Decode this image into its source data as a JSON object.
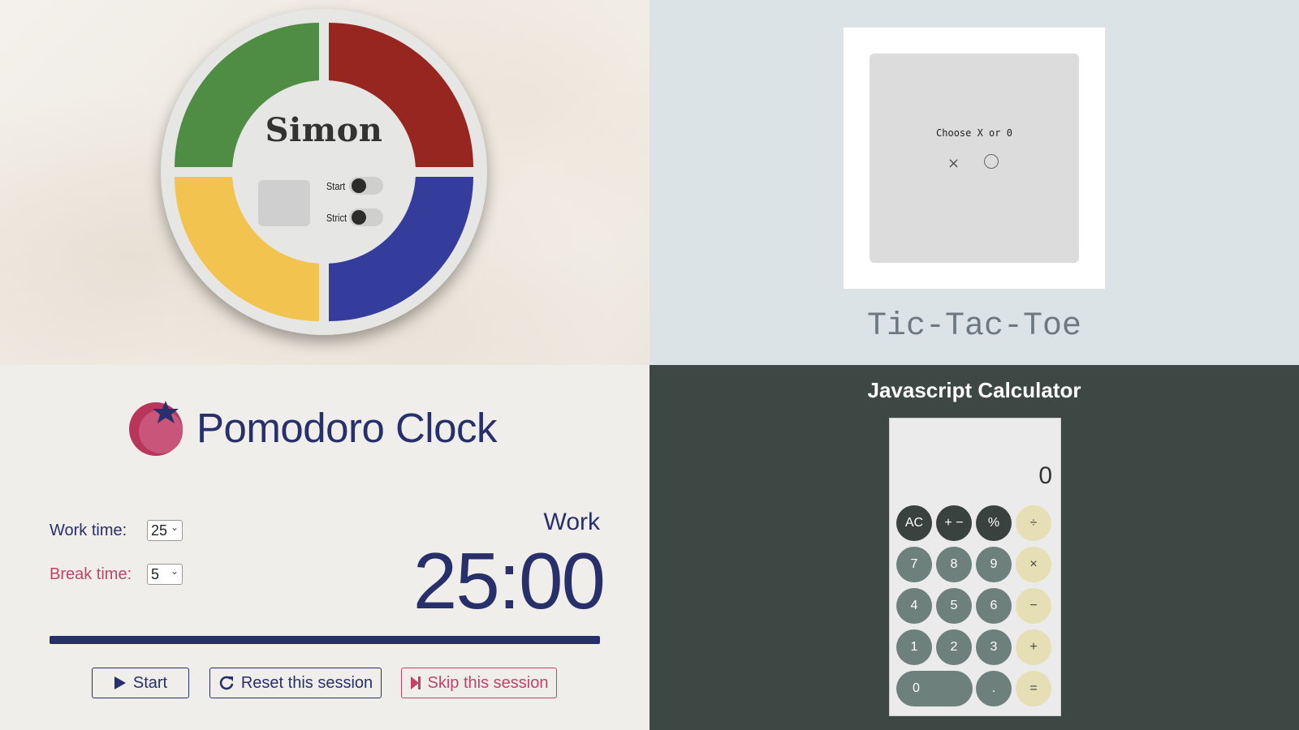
{
  "simon": {
    "title": "Simon",
    "start_label": "Start",
    "strict_label": "Strict",
    "colors": {
      "green": "#4f8d44",
      "red": "#972620",
      "yellow": "#f2c34e",
      "blue": "#343d9b"
    }
  },
  "tictactoe": {
    "prompt": "Choose X or 0",
    "choice_x": "×",
    "title": "Tic-Tac-Toe"
  },
  "pomodoro": {
    "title": "Pomodoro Clock",
    "work_label": "Work time:",
    "work_value": "25",
    "break_label": "Break time:",
    "break_value": "5",
    "mode": "Work",
    "time": "25:00",
    "progress_percent": 100,
    "start_label": "Start",
    "reset_label": "Reset this session",
    "skip_label": "Skip this session",
    "colors": {
      "primary": "#27306b",
      "accent": "#c14466"
    }
  },
  "calculator": {
    "title": "Javascript Calculator",
    "display": "0",
    "rows": [
      [
        {
          "label": "AC",
          "kind": "dark"
        },
        {
          "label": "+ −",
          "kind": "dark"
        },
        {
          "label": "%",
          "kind": "dark"
        },
        {
          "label": "÷",
          "kind": "op"
        }
      ],
      [
        {
          "label": "7",
          "kind": "num"
        },
        {
          "label": "8",
          "kind": "num"
        },
        {
          "label": "9",
          "kind": "num"
        },
        {
          "label": "×",
          "kind": "op"
        }
      ],
      [
        {
          "label": "4",
          "kind": "num"
        },
        {
          "label": "5",
          "kind": "num"
        },
        {
          "label": "6",
          "kind": "num"
        },
        {
          "label": "−",
          "kind": "op"
        }
      ],
      [
        {
          "label": "1",
          "kind": "num"
        },
        {
          "label": "2",
          "kind": "num"
        },
        {
          "label": "3",
          "kind": "num"
        },
        {
          "label": "+",
          "kind": "op"
        }
      ],
      [
        {
          "label": "0",
          "kind": "num",
          "wide": true
        },
        {
          "label": ".",
          "kind": "num"
        },
        {
          "label": "=",
          "kind": "op"
        }
      ]
    ]
  }
}
